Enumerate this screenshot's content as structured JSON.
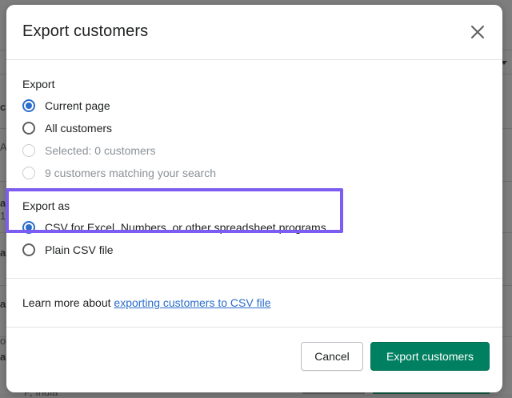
{
  "background": {
    "fragments": [
      "c",
      "A",
      "1",
      "a",
      "a",
      "a",
      "a",
      "or",
      "P, India"
    ]
  },
  "modal": {
    "title": "Export customers",
    "close_icon": "close-icon",
    "export_section": {
      "label": "Export",
      "options": [
        {
          "label": "Current page",
          "checked": true,
          "disabled": false
        },
        {
          "label": "All customers",
          "checked": false,
          "disabled": false
        },
        {
          "label": "Selected: 0 customers",
          "checked": false,
          "disabled": true
        },
        {
          "label": "9 customers matching your search",
          "checked": false,
          "disabled": true
        }
      ]
    },
    "export_as_section": {
      "label": "Export as",
      "options": [
        {
          "label": "CSV for Excel, Numbers, or other spreadsheet programs",
          "checked": true,
          "disabled": false
        },
        {
          "label": "Plain CSV file",
          "checked": false,
          "disabled": false
        }
      ]
    },
    "learn_more": {
      "prefix": "Learn more about ",
      "link_text": "exporting customers to CSV file"
    },
    "footer": {
      "cancel_label": "Cancel",
      "primary_label": "Export customers"
    }
  },
  "colors": {
    "accent": "#2c6ecb",
    "primary_button": "#008060",
    "highlight": "#7d5cf1"
  }
}
